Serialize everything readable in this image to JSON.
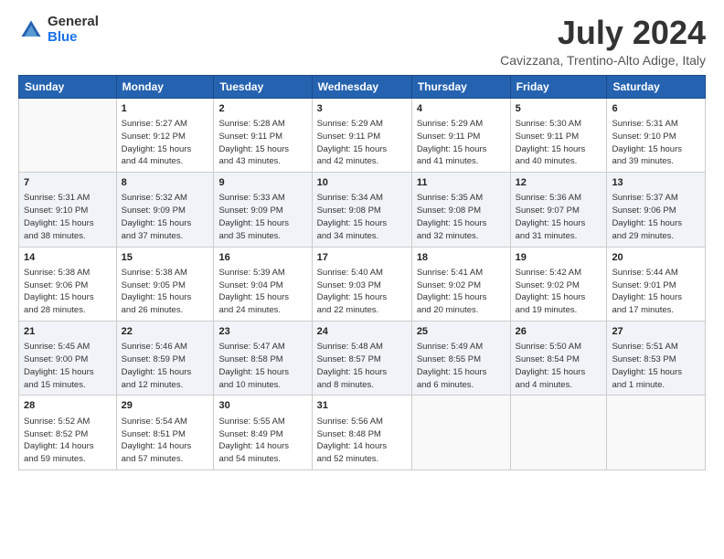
{
  "logo": {
    "general": "General",
    "blue": "Blue"
  },
  "title": "July 2024",
  "subtitle": "Cavizzana, Trentino-Alto Adige, Italy",
  "weekdays": [
    "Sunday",
    "Monday",
    "Tuesday",
    "Wednesday",
    "Thursday",
    "Friday",
    "Saturday"
  ],
  "weeks": [
    [
      {
        "day": "",
        "info": ""
      },
      {
        "day": "1",
        "info": "Sunrise: 5:27 AM\nSunset: 9:12 PM\nDaylight: 15 hours\nand 44 minutes."
      },
      {
        "day": "2",
        "info": "Sunrise: 5:28 AM\nSunset: 9:11 PM\nDaylight: 15 hours\nand 43 minutes."
      },
      {
        "day": "3",
        "info": "Sunrise: 5:29 AM\nSunset: 9:11 PM\nDaylight: 15 hours\nand 42 minutes."
      },
      {
        "day": "4",
        "info": "Sunrise: 5:29 AM\nSunset: 9:11 PM\nDaylight: 15 hours\nand 41 minutes."
      },
      {
        "day": "5",
        "info": "Sunrise: 5:30 AM\nSunset: 9:11 PM\nDaylight: 15 hours\nand 40 minutes."
      },
      {
        "day": "6",
        "info": "Sunrise: 5:31 AM\nSunset: 9:10 PM\nDaylight: 15 hours\nand 39 minutes."
      }
    ],
    [
      {
        "day": "7",
        "info": "Sunrise: 5:31 AM\nSunset: 9:10 PM\nDaylight: 15 hours\nand 38 minutes."
      },
      {
        "day": "8",
        "info": "Sunrise: 5:32 AM\nSunset: 9:09 PM\nDaylight: 15 hours\nand 37 minutes."
      },
      {
        "day": "9",
        "info": "Sunrise: 5:33 AM\nSunset: 9:09 PM\nDaylight: 15 hours\nand 35 minutes."
      },
      {
        "day": "10",
        "info": "Sunrise: 5:34 AM\nSunset: 9:08 PM\nDaylight: 15 hours\nand 34 minutes."
      },
      {
        "day": "11",
        "info": "Sunrise: 5:35 AM\nSunset: 9:08 PM\nDaylight: 15 hours\nand 32 minutes."
      },
      {
        "day": "12",
        "info": "Sunrise: 5:36 AM\nSunset: 9:07 PM\nDaylight: 15 hours\nand 31 minutes."
      },
      {
        "day": "13",
        "info": "Sunrise: 5:37 AM\nSunset: 9:06 PM\nDaylight: 15 hours\nand 29 minutes."
      }
    ],
    [
      {
        "day": "14",
        "info": "Sunrise: 5:38 AM\nSunset: 9:06 PM\nDaylight: 15 hours\nand 28 minutes."
      },
      {
        "day": "15",
        "info": "Sunrise: 5:38 AM\nSunset: 9:05 PM\nDaylight: 15 hours\nand 26 minutes."
      },
      {
        "day": "16",
        "info": "Sunrise: 5:39 AM\nSunset: 9:04 PM\nDaylight: 15 hours\nand 24 minutes."
      },
      {
        "day": "17",
        "info": "Sunrise: 5:40 AM\nSunset: 9:03 PM\nDaylight: 15 hours\nand 22 minutes."
      },
      {
        "day": "18",
        "info": "Sunrise: 5:41 AM\nSunset: 9:02 PM\nDaylight: 15 hours\nand 20 minutes."
      },
      {
        "day": "19",
        "info": "Sunrise: 5:42 AM\nSunset: 9:02 PM\nDaylight: 15 hours\nand 19 minutes."
      },
      {
        "day": "20",
        "info": "Sunrise: 5:44 AM\nSunset: 9:01 PM\nDaylight: 15 hours\nand 17 minutes."
      }
    ],
    [
      {
        "day": "21",
        "info": "Sunrise: 5:45 AM\nSunset: 9:00 PM\nDaylight: 15 hours\nand 15 minutes."
      },
      {
        "day": "22",
        "info": "Sunrise: 5:46 AM\nSunset: 8:59 PM\nDaylight: 15 hours\nand 12 minutes."
      },
      {
        "day": "23",
        "info": "Sunrise: 5:47 AM\nSunset: 8:58 PM\nDaylight: 15 hours\nand 10 minutes."
      },
      {
        "day": "24",
        "info": "Sunrise: 5:48 AM\nSunset: 8:57 PM\nDaylight: 15 hours\nand 8 minutes."
      },
      {
        "day": "25",
        "info": "Sunrise: 5:49 AM\nSunset: 8:55 PM\nDaylight: 15 hours\nand 6 minutes."
      },
      {
        "day": "26",
        "info": "Sunrise: 5:50 AM\nSunset: 8:54 PM\nDaylight: 15 hours\nand 4 minutes."
      },
      {
        "day": "27",
        "info": "Sunrise: 5:51 AM\nSunset: 8:53 PM\nDaylight: 15 hours\nand 1 minute."
      }
    ],
    [
      {
        "day": "28",
        "info": "Sunrise: 5:52 AM\nSunset: 8:52 PM\nDaylight: 14 hours\nand 59 minutes."
      },
      {
        "day": "29",
        "info": "Sunrise: 5:54 AM\nSunset: 8:51 PM\nDaylight: 14 hours\nand 57 minutes."
      },
      {
        "day": "30",
        "info": "Sunrise: 5:55 AM\nSunset: 8:49 PM\nDaylight: 14 hours\nand 54 minutes."
      },
      {
        "day": "31",
        "info": "Sunrise: 5:56 AM\nSunset: 8:48 PM\nDaylight: 14 hours\nand 52 minutes."
      },
      {
        "day": "",
        "info": ""
      },
      {
        "day": "",
        "info": ""
      },
      {
        "day": "",
        "info": ""
      }
    ]
  ]
}
